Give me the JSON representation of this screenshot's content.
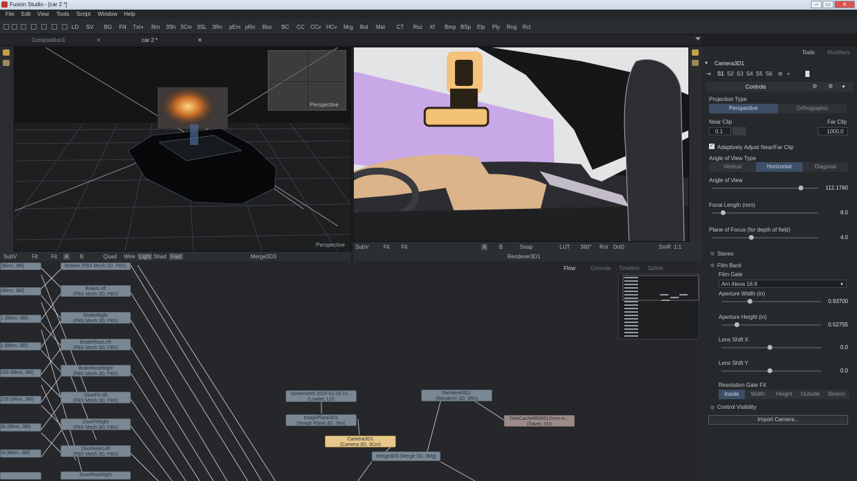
{
  "window": {
    "title": "Fusion Studio - [car 2 *]",
    "min": "–",
    "max": "▭",
    "close": "✕"
  },
  "menu": [
    "File",
    "Edit",
    "View",
    "Tools",
    "Script",
    "Window",
    "Help"
  ],
  "toolbar": [
    "LD",
    "SV",
    "BG",
    "FN",
    "Txt+",
    "3Im",
    "3Sh",
    "3Cm",
    "3SL",
    "3Rn",
    "pEm",
    "pRn",
    "Blur",
    "BC",
    "CC",
    "CCv",
    "HCv",
    "Mrg",
    "Bol",
    "Mat",
    "CT",
    "Rsz",
    "Xf",
    "Bmp",
    "BSp",
    "Elp",
    "Ply",
    "Rng",
    "Rct"
  ],
  "tabs": [
    {
      "label": "Composition1"
    },
    {
      "label": "car 2 *"
    }
  ],
  "left_viewer": {
    "label": "Merge3D3",
    "perspective_top": "Perspective",
    "perspective_bottom": "Perspective",
    "controls": [
      "SubV",
      "Fit",
      "Fit",
      "A",
      "B",
      "Quad",
      "Wire",
      "Light",
      "Shad",
      "Fast"
    ]
  },
  "right_viewer": {
    "label": "Renderer3D1",
    "controls": [
      "SubV",
      "Fit",
      "Fit",
      "A",
      "B",
      "Snap",
      "LUT",
      "360°",
      "Rol",
      "DoD",
      "SmR",
      "1:1"
    ]
  },
  "flow_tabs": [
    "Flow",
    "Console",
    "Timeline",
    "Spline"
  ],
  "nodes": [
    {
      "l1": "Bottom (FBX Mesh 3D, FBX)",
      "l2": ""
    },
    {
      "l1": "BrakeLeft",
      "l2": "(FBX Mesh 3D, FBX)"
    },
    {
      "l1": "BrakeRight",
      "l2": "(FBX Mesh 3D, FBX)"
    },
    {
      "l1": "BrakeRearLeft",
      "l2": "(FBX Mesh 3D, FBX)"
    },
    {
      "l1": "BrakeRearRight",
      "l2": "(FBX Mesh 3D, FBX)"
    },
    {
      "l1": "DoorFrLeft",
      "l2": "(FBX Mesh 3D, FBX)"
    },
    {
      "l1": "DoorFrRight",
      "l2": "(FBX Mesh 3D, FBX)"
    },
    {
      "l1": "DoorRearLeft",
      "l2": "(FBX Mesh 3D, FBX)"
    },
    {
      "l1": "DoorRearRight",
      "l2": ""
    },
    {
      "l1": "Screenshot 2019-01-28 15...",
      "l2": "(Loader, LD)"
    },
    {
      "l1": "ImagePlane3D1",
      "l2": "(Image Plane 3D, 3Im)"
    },
    {
      "l1": "Camera3D1",
      "l2": "(Camera 3D, 3Cm)"
    },
    {
      "l1": "Merge3D3 (Merge 3D, 3Mg)",
      "l2": ""
    },
    {
      "l1": "Renderer3D1",
      "l2": "(Renderer 3D, 3Rn)"
    },
    {
      "l1": "DiskCache6666612mm.m...",
      "l2": "(Saver, SV)"
    }
  ],
  "left_nodes": [
    "(Blinn, 3Bl)",
    "(Blinn, 3Bl)",
    "1 (Blinn, 3Bl)",
    "s (Blinn, 3Bl)",
    "028 (Blinn, 3Bl)",
    "229 (Blinn, 3Bl)",
    "3k (Blinn, 3Bl)",
    "rd (Blinn, 3Bl)",
    ""
  ],
  "inspector": {
    "tabs": [
      "Tools",
      "Modifiers"
    ],
    "tool_name": "Camera3D1",
    "slots": [
      "S1",
      "S2",
      "S3",
      "S4",
      "S5",
      "S6"
    ],
    "section": "Controls",
    "projection_type": "Projection Type",
    "proj_options": [
      "Perspective",
      "Orthographic"
    ],
    "near_clip_label": "Near Clip",
    "far_clip_label": "Far Clip",
    "near_clip": "0.1",
    "far_clip": "1000.0",
    "adaptive": "Adaptively Adjust Near/Far Clip",
    "aov_type": "Angle of View Type",
    "aov_options": [
      "Vertical",
      "Horizontal",
      "Diagonal"
    ],
    "params": [
      {
        "label": "Angle of View",
        "value": "112.1760",
        "pos": 0.83
      },
      {
        "label": "Focal Length (mm)",
        "value": "8.0",
        "pos": 0.1
      },
      {
        "label": "Plane of Focus (for depth of field)",
        "value": "4.0",
        "pos": 0.37
      }
    ],
    "stereo": "Stereo",
    "film_back": "Film Back",
    "film_gate": "Film Gate",
    "film_gate_value": "Arri Alexa 16:9",
    "film_params": [
      {
        "label": "Aperture Width (in)",
        "value": "0.93700",
        "pos": 0.28
      },
      {
        "label": "Aperture Height (in)",
        "value": "0.52755",
        "pos": 0.15
      },
      {
        "label": "Lens Shift X",
        "value": "0.0",
        "pos": 0.48
      },
      {
        "label": "Lens Shift Y",
        "value": "0.0",
        "pos": 0.48
      }
    ],
    "res_gate_fit": "Resolution Gate Fit",
    "res_options": [
      "Inside",
      "Width",
      "Height",
      "Outside",
      "Stretch"
    ],
    "control_visibility": "Control Visibility",
    "import_camera": "Import Camera..."
  }
}
